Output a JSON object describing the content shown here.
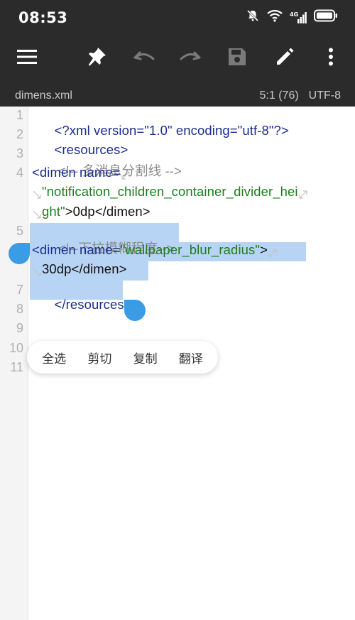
{
  "status_bar": {
    "time": "08:53",
    "network_label": "4G"
  },
  "toolbar": {
    "icons": [
      "menu-icon",
      "pin-icon",
      "undo-icon",
      "redo-icon",
      "save-icon",
      "edit-icon",
      "more-icon"
    ]
  },
  "file": {
    "name": "dimens.xml",
    "cursor": "5:1 (76)",
    "encoding": "UTF-8"
  },
  "editor": {
    "line_numbers": [
      "1",
      "2",
      "3",
      "4",
      "5",
      "6",
      "7",
      "8",
      "9",
      "10",
      "11"
    ],
    "lines": {
      "l1": {
        "text": "<?xml version=\"1.0\" encoding=\"utf-8\"?>"
      },
      "l2": {
        "text": "<resources>"
      },
      "l3": {
        "text": " <!-- 多消息分割线 -->"
      },
      "l4a": {
        "tag_open": "<dimen",
        "attr": " name="
      },
      "l4b": {
        "str": "\"notification_children_container_divider_hei"
      },
      "l4c": {
        "str": "ght\"",
        "rest": ">0dp</dimen>"
      },
      "l5": {
        "text": " <!--下拉模糊程度-->"
      },
      "l6a": {
        "tag_open": "<dimen",
        "attr": " name=",
        "str": "\"wallpaper_blur_radius\"",
        "end": ">"
      },
      "l6b": {
        "rest": "30dp</dimen>"
      },
      "l7": {
        "text": "</resources>"
      }
    }
  },
  "context_menu": {
    "select_all": "全选",
    "cut": "剪切",
    "copy": "复制",
    "translate": "翻译"
  },
  "colors": {
    "toolbar_bg": "#2b2b2b",
    "selection": "#b8d4f4",
    "handle": "#3b9ce6",
    "tag": "#1b2d8f",
    "string": "#1e7c1e",
    "comment": "#8a8a8a"
  }
}
